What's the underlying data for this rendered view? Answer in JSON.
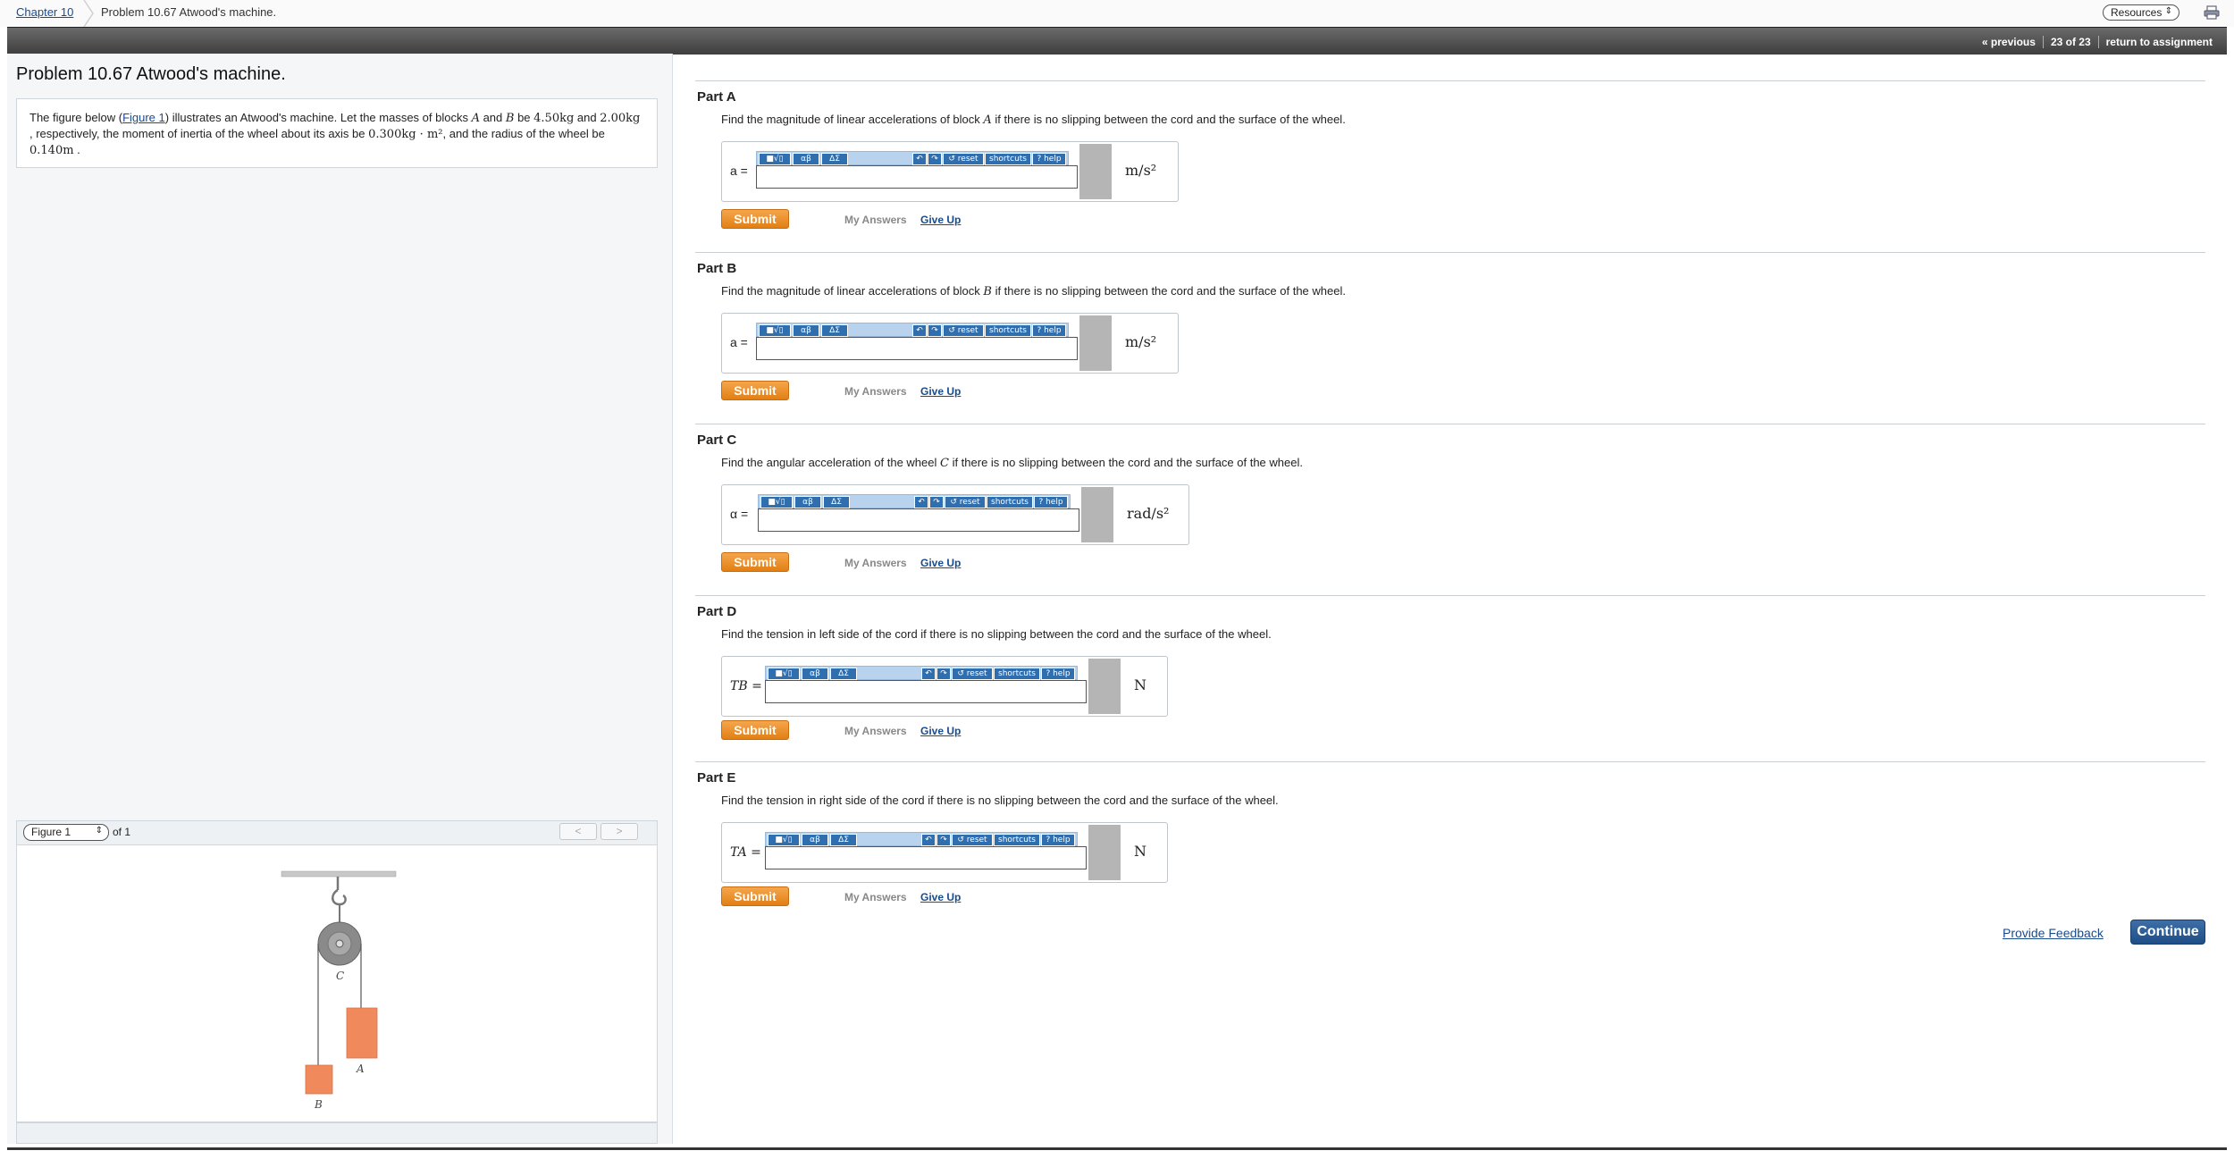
{
  "breadcrumb": {
    "chapter": "Chapter 10",
    "title": "Problem 10.67 Atwood's machine."
  },
  "header": {
    "resources_label": "Resources",
    "previous": "« previous",
    "position": "23 of 23",
    "return_label": "return to assignment"
  },
  "problem": {
    "title": "Problem 10.67 Atwood's machine.",
    "statement": {
      "t1": "The figure below (",
      "figure_link": "Figure 1",
      "t2": ") illustrates an Atwood's machine. Let the masses of blocks ",
      "blockA": "A",
      "t3": " and ",
      "blockB": "B",
      "t4": " be ",
      "massA": "4.50kg",
      "t5": " and ",
      "massB": "2.00kg",
      "t6": " , respectively, the moment of inertia of the wheel about its axis be ",
      "inertia": "0.300kg · m²",
      "t7": ", and the radius of the wheel be ",
      "radius": "0.140m",
      "t8": " ."
    }
  },
  "figure": {
    "select_value": "Figure 1",
    "of_label": "of 1",
    "prev": "<",
    "next": ">",
    "labels": {
      "wheel": "C",
      "blockA": "A",
      "blockB": "B"
    },
    "colors": {
      "block": "#f08a5d",
      "wheel": "#8a8a8a"
    }
  },
  "toolbar": {
    "templates": "■√▯",
    "greek": "αβ",
    "symbols": "ΔΣ",
    "undo": "↶",
    "redo": "↷",
    "reset": "↺ reset",
    "shortcuts": "shortcuts",
    "help": "? help"
  },
  "parts": [
    {
      "title": "Part A",
      "q1": "Find the magnitude of linear accelerations of block ",
      "var": "A",
      "q2": " if there is no slipping between the cord and the surface of the wheel.",
      "label": "a =",
      "unit": "m/s²"
    },
    {
      "title": "Part B",
      "q1": "Find the magnitude of linear accelerations of block ",
      "var": "B",
      "q2": " if there is no slipping between the cord and the surface of the wheel.",
      "label": "a =",
      "unit": "m/s²"
    },
    {
      "title": "Part C",
      "q1": "Find the angular acceleration of the wheel ",
      "var": "C",
      "q2": " if there is no slipping between the cord and the surface of the wheel.",
      "label": "α =",
      "unit": "rad/s²"
    },
    {
      "title": "Part D",
      "q1": "Find the tension in left side of the cord if there is no slipping between the cord and the surface of the wheel.",
      "var": "",
      "q2": "",
      "label": "TB =",
      "unit": "N"
    },
    {
      "title": "Part E",
      "q1": "Find the tension in right side of the cord if there is no slipping between the cord and the surface of the wheel.",
      "var": "",
      "q2": "",
      "label": "TA =",
      "unit": "N"
    }
  ],
  "actions": {
    "submit": "Submit",
    "my_answers": "My Answers",
    "give_up": "Give Up"
  },
  "footer": {
    "feedback": "Provide Feedback",
    "continue": "Continue"
  },
  "colors": {
    "submit": "#e8891f",
    "continue": "#2a5a94",
    "toolbar_btn": "#2f6fb0"
  }
}
